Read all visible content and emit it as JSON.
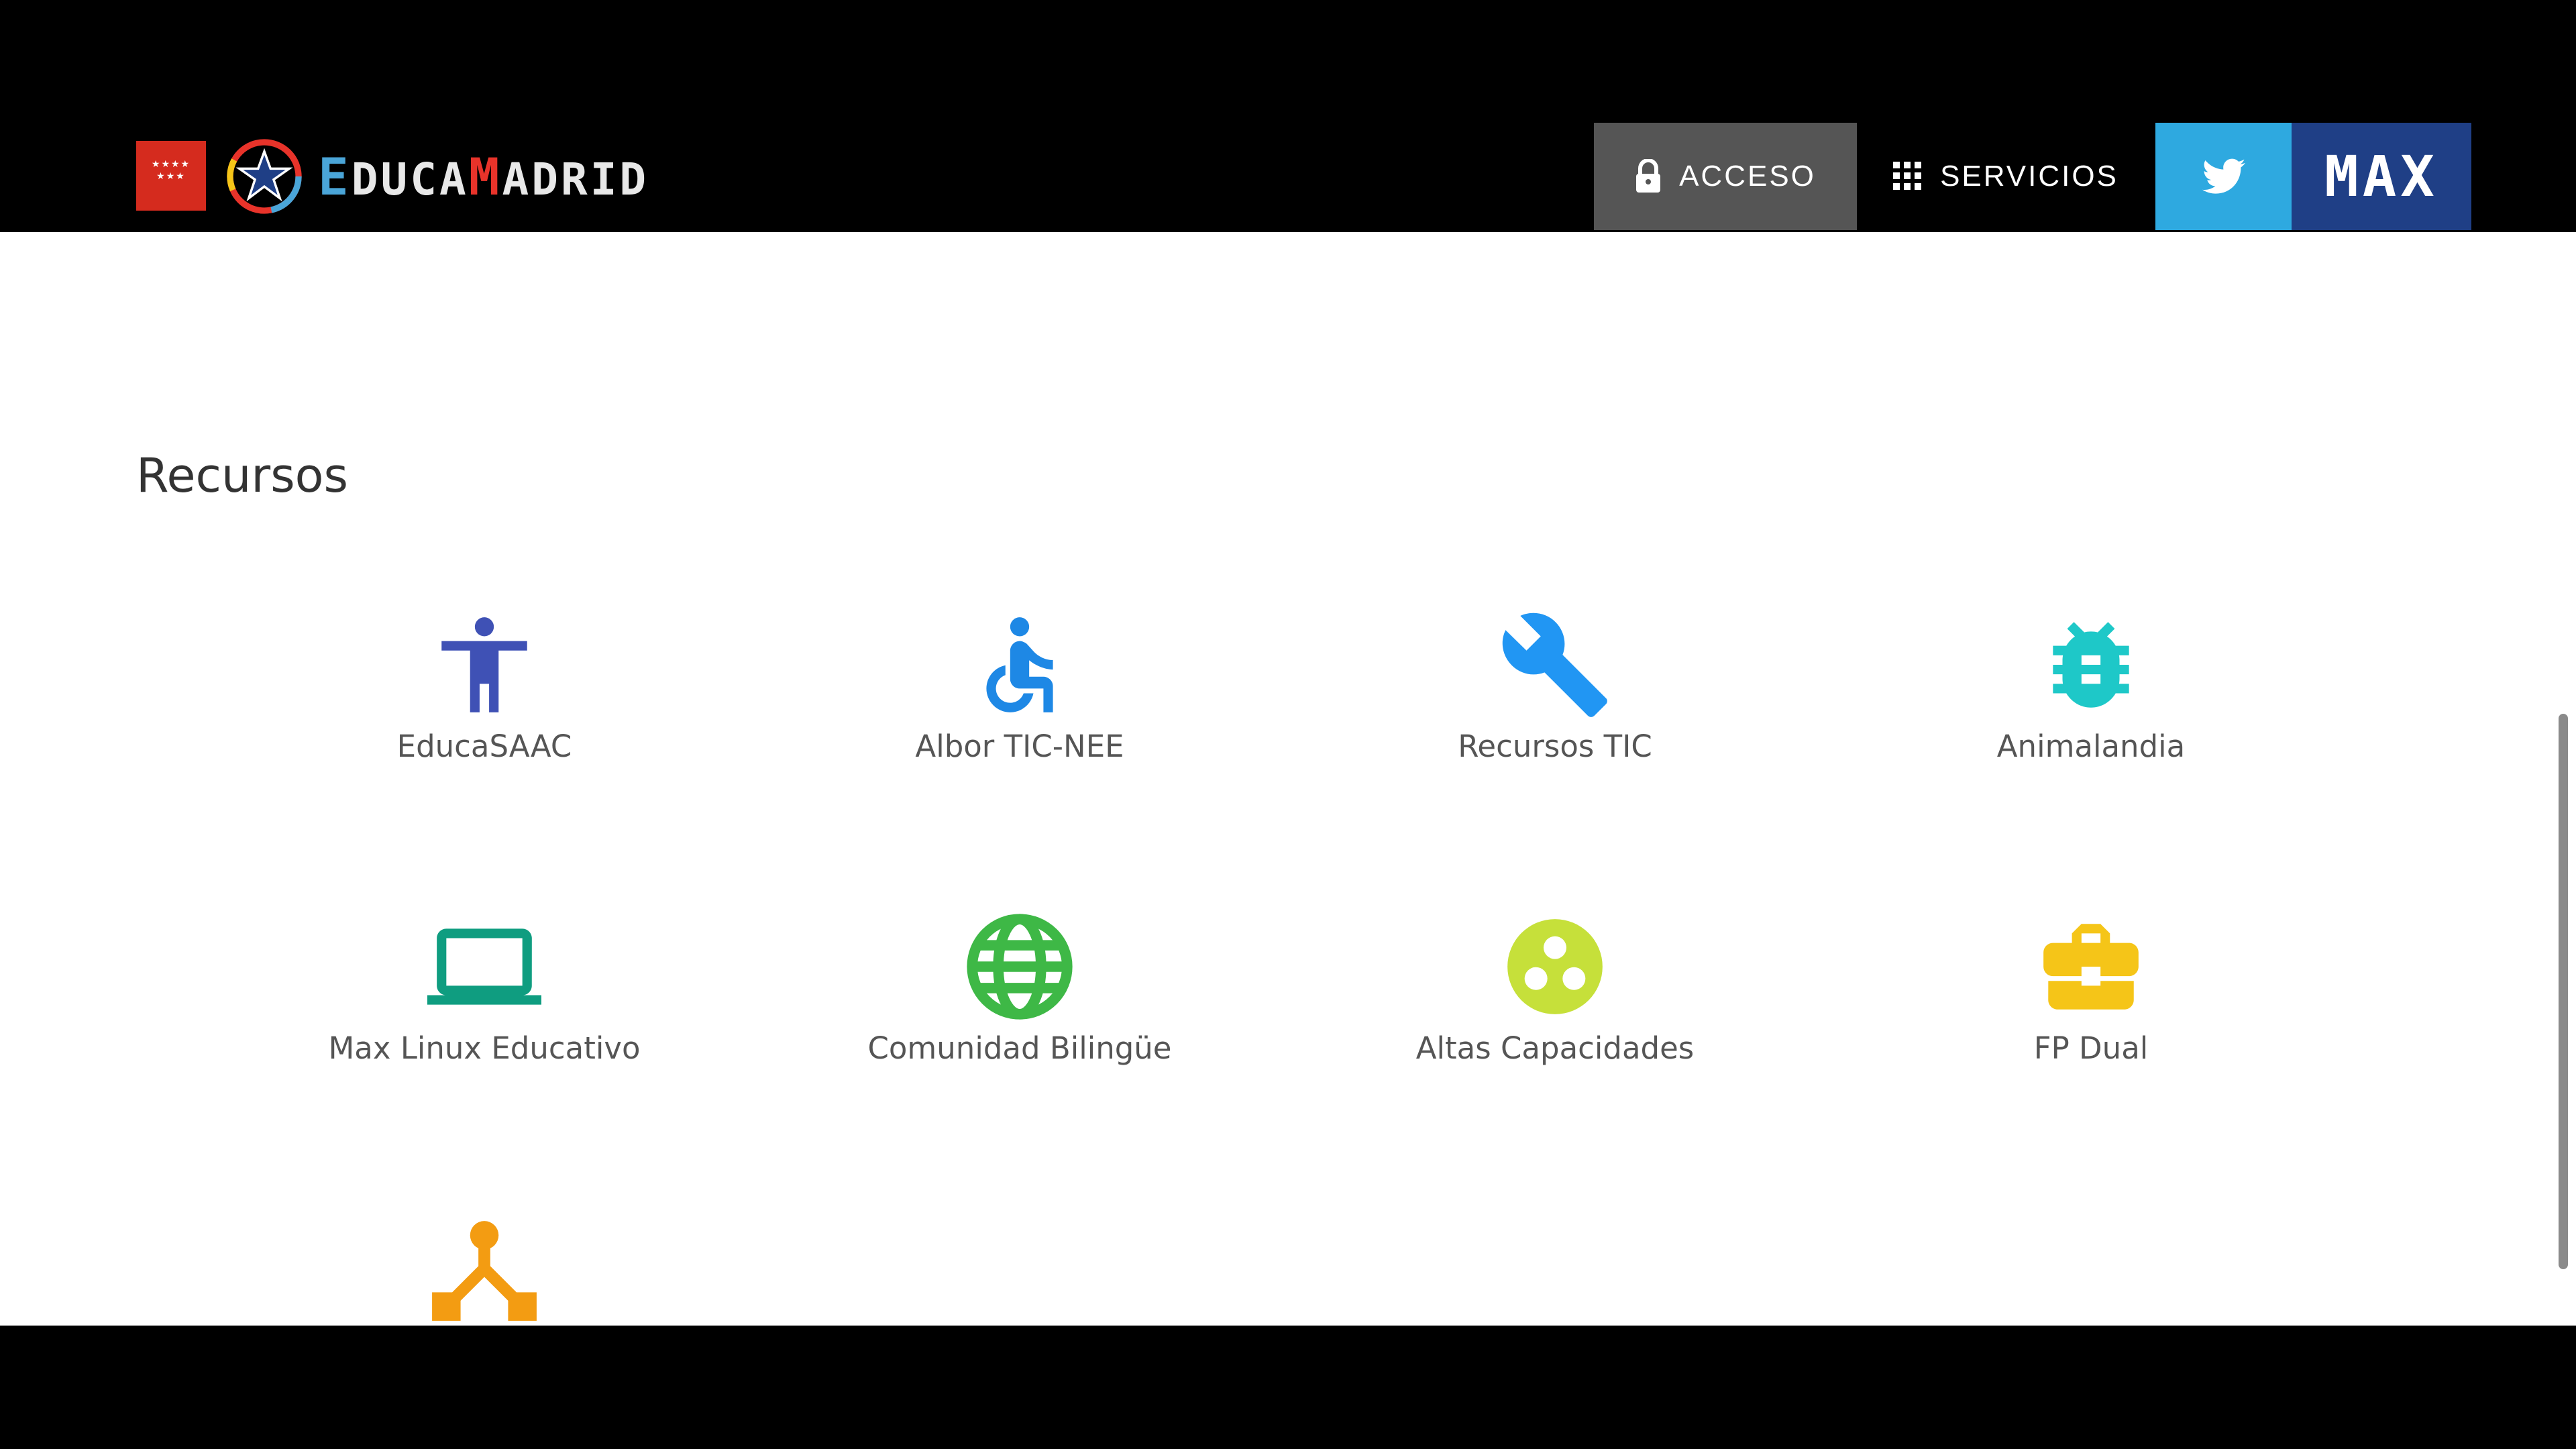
{
  "header": {
    "logo_text": "EducaMadrid",
    "acceso_label": "ACCESO",
    "servicios_label": "SERVICIOS",
    "max_label": "MAX"
  },
  "main": {
    "section_title": "Recursos",
    "resources": [
      {
        "label": "EducaSAAC",
        "icon": "accessibility-icon",
        "color": "#3f51b5"
      },
      {
        "label": "Albor TIC-NEE",
        "icon": "wheelchair-icon",
        "color": "#1e88e5"
      },
      {
        "label": "Recursos TIC",
        "icon": "wrench-icon",
        "color": "#2196f3"
      },
      {
        "label": "Animalandia",
        "icon": "bug-icon",
        "color": "#1ec8c8"
      },
      {
        "label": "Max Linux Educativo",
        "icon": "laptop-icon",
        "color": "#0f9d80"
      },
      {
        "label": "Comunidad Bilingüe",
        "icon": "globe-icon",
        "color": "#3eb846"
      },
      {
        "label": "Altas Capacidades",
        "icon": "bubbles-icon",
        "color": "#c6e03a"
      },
      {
        "label": "FP Dual",
        "icon": "briefcase-icon",
        "color": "#f5c518"
      },
      {
        "label": "",
        "icon": "network-icon",
        "color": "#f39c12"
      }
    ]
  },
  "colors": {
    "header_bg": "#000000",
    "acceso_bg": "#555555",
    "twitter_bg": "#2ea9e0",
    "max_bg": "#1f3f86",
    "region_red": "#d52b1e"
  }
}
